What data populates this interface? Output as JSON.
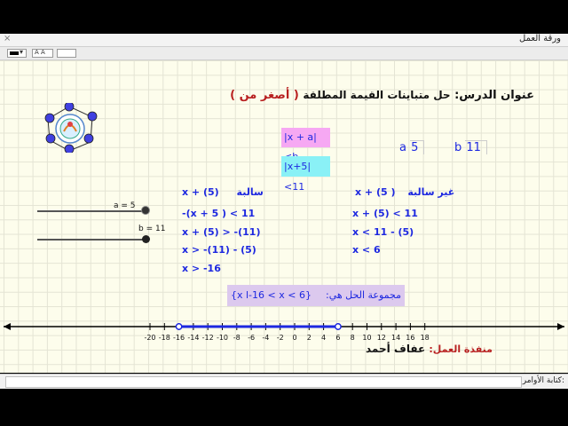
{
  "window": {
    "title": "ورقة العمل",
    "close_glyph": "×"
  },
  "stylebar": {
    "color_swatch": "#000000",
    "text_style": "A A",
    "arrow": "▾"
  },
  "lesson": {
    "title_label": "عنوان الدرس:",
    "title_text": "حل متباينات القيمة المطلقة",
    "title_paren": "( أصغر من )",
    "general_form": "|x + a|<b",
    "problem": "|x+5|<11"
  },
  "params": {
    "a_label": "a",
    "a_value": "5",
    "b_label": "b",
    "b_value": "11"
  },
  "sliders": {
    "a_label": "a = 5",
    "b_label": "b = 11"
  },
  "negative_case": {
    "heading": "سالبة",
    "header_expr": "x + (5)",
    "steps": [
      "-(x + 5 ) < 11",
      "x + (5) > -(11)",
      "x > -(11) - (5)",
      "x > -16"
    ]
  },
  "positive_case": {
    "heading": "غير سالبة",
    "header_expr": "x + (5 )",
    "steps": [
      "x + (5) < 11",
      "x < 11 - (5)",
      "x < 6"
    ]
  },
  "solution": {
    "label": "مجموعة الحل هي:",
    "set": "{x l-16 < x < 6}"
  },
  "number_line": {
    "ticks": [
      "-20",
      "-18",
      "-16",
      "-14",
      "-12",
      "-10",
      "-8",
      "-6",
      "-4",
      "-2",
      "0",
      "2",
      "4",
      "6",
      "8",
      "10",
      "12",
      "14",
      "16",
      "18"
    ],
    "interval_start": -16,
    "interval_end": 6
  },
  "credits": {
    "label": "منفذة العمل:",
    "name": "عفاف أحمد"
  },
  "command_bar": {
    "label": "كتابة الأوامر:",
    "value": ""
  },
  "colors": {
    "background": "#fdfdec",
    "accent_blue": "#1d28e0",
    "pink": "#f6a8f3",
    "cyan": "#8af1f6",
    "lavender": "#dcc9ee"
  }
}
